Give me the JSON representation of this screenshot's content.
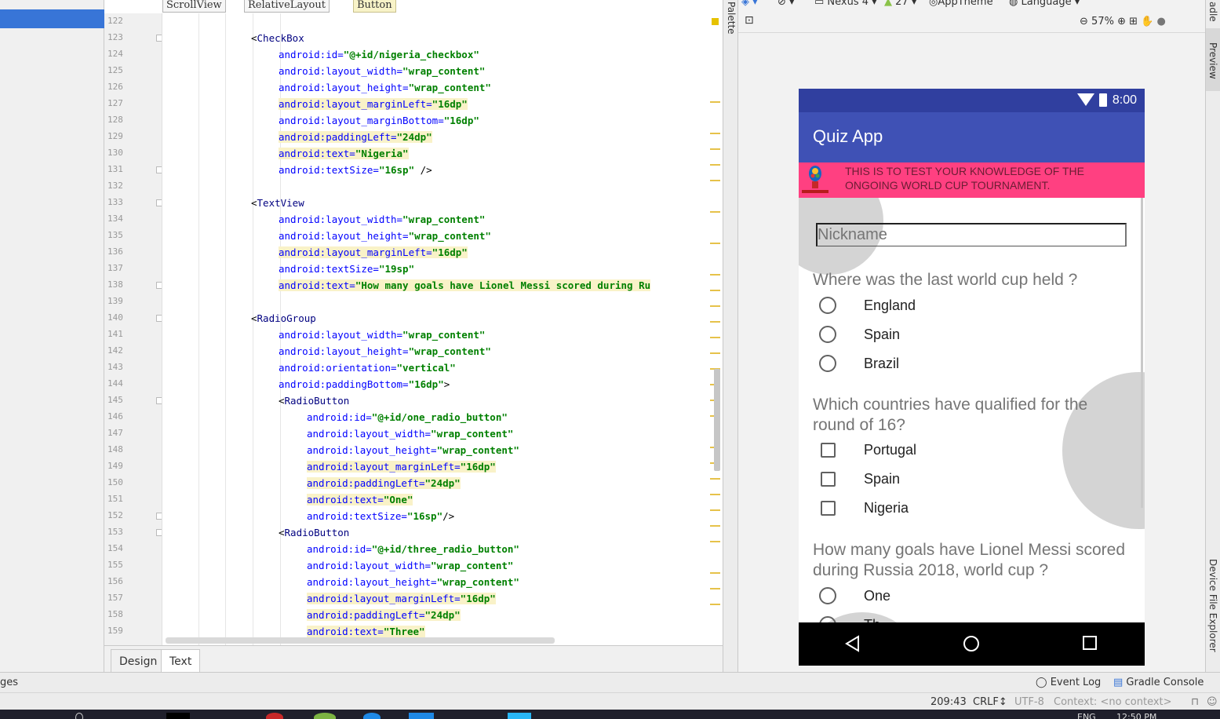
{
  "breadcrumb": [
    "ScrollView",
    "RelativeLayout",
    "Button"
  ],
  "gutter": {
    "line_numbers": [
      "122",
      "123",
      "124",
      "125",
      "126",
      "127",
      "128",
      "129",
      "130",
      "131",
      "132",
      "133",
      "134",
      "135",
      "136",
      "137",
      "138",
      "139",
      "140",
      "141",
      "142",
      "143",
      "144",
      "145",
      "146",
      "147",
      "148",
      "149",
      "150",
      "151",
      "152",
      "153",
      "154",
      "155",
      "156",
      "157",
      "158",
      "159"
    ]
  },
  "code_lines": [
    {
      "indent": 0,
      "parts": []
    },
    {
      "indent": 1,
      "parts": [
        {
          "t": "<",
          "c": "punc"
        },
        {
          "t": "CheckBox",
          "c": "tag"
        }
      ]
    },
    {
      "indent": 2,
      "hl": false,
      "parts": [
        {
          "t": "android:id=",
          "c": "attr"
        },
        {
          "t": "\"@+id/nigeria_checkbox\"",
          "c": "val"
        }
      ]
    },
    {
      "indent": 2,
      "hl": false,
      "parts": [
        {
          "t": "android:layout_width=",
          "c": "attr"
        },
        {
          "t": "\"wrap_content\"",
          "c": "val"
        }
      ]
    },
    {
      "indent": 2,
      "hl": false,
      "parts": [
        {
          "t": "android:layout_height=",
          "c": "attr"
        },
        {
          "t": "\"wrap_content\"",
          "c": "val"
        }
      ]
    },
    {
      "indent": 2,
      "hl": true,
      "parts": [
        {
          "t": "android:layout_marginLeft=",
          "c": "attr"
        },
        {
          "t": "\"16dp\"",
          "c": "val"
        }
      ]
    },
    {
      "indent": 2,
      "hl": false,
      "parts": [
        {
          "t": "android:layout_marginBottom=",
          "c": "attr"
        },
        {
          "t": "\"16dp\"",
          "c": "val"
        }
      ]
    },
    {
      "indent": 2,
      "hl": true,
      "parts": [
        {
          "t": "android:paddingLeft=",
          "c": "attr"
        },
        {
          "t": "\"24dp\"",
          "c": "val"
        }
      ]
    },
    {
      "indent": 2,
      "hl": true,
      "parts": [
        {
          "t": "android:text=",
          "c": "attr"
        },
        {
          "t": "\"Nigeria\"",
          "c": "val"
        }
      ]
    },
    {
      "indent": 2,
      "hl": false,
      "parts": [
        {
          "t": "android:textSize=",
          "c": "attr"
        },
        {
          "t": "\"16sp\"",
          "c": "val"
        },
        {
          "t": " />",
          "c": "punc"
        }
      ]
    },
    {
      "indent": 0,
      "parts": []
    },
    {
      "indent": 1,
      "parts": [
        {
          "t": "<",
          "c": "punc"
        },
        {
          "t": "TextView",
          "c": "tag"
        }
      ]
    },
    {
      "indent": 2,
      "hl": false,
      "parts": [
        {
          "t": "android:layout_width=",
          "c": "attr"
        },
        {
          "t": "\"wrap_content\"",
          "c": "val"
        }
      ]
    },
    {
      "indent": 2,
      "hl": false,
      "parts": [
        {
          "t": "android:layout_height=",
          "c": "attr"
        },
        {
          "t": "\"wrap_content\"",
          "c": "val"
        }
      ]
    },
    {
      "indent": 2,
      "hl": true,
      "parts": [
        {
          "t": "android:layout_marginLeft=",
          "c": "attr"
        },
        {
          "t": "\"16dp\"",
          "c": "val"
        }
      ]
    },
    {
      "indent": 2,
      "hl": false,
      "parts": [
        {
          "t": "android:textSize=",
          "c": "attr"
        },
        {
          "t": "\"19sp\"",
          "c": "val"
        }
      ]
    },
    {
      "indent": 2,
      "hl": true,
      "parts": [
        {
          "t": "android:text=",
          "c": "attr"
        },
        {
          "t": "\"How many goals have Lionel Messi scored during Ru",
          "c": "val"
        }
      ]
    },
    {
      "indent": 0,
      "parts": []
    },
    {
      "indent": 1,
      "parts": [
        {
          "t": "<",
          "c": "punc"
        },
        {
          "t": "RadioGroup",
          "c": "tag"
        }
      ]
    },
    {
      "indent": 2,
      "hl": false,
      "parts": [
        {
          "t": "android:layout_width=",
          "c": "attr"
        },
        {
          "t": "\"wrap_content\"",
          "c": "val"
        }
      ]
    },
    {
      "indent": 2,
      "hl": false,
      "parts": [
        {
          "t": "android:layout_height=",
          "c": "attr"
        },
        {
          "t": "\"wrap_content\"",
          "c": "val"
        }
      ]
    },
    {
      "indent": 2,
      "hl": false,
      "parts": [
        {
          "t": "android:orientation=",
          "c": "attr"
        },
        {
          "t": "\"vertical\"",
          "c": "val"
        }
      ]
    },
    {
      "indent": 2,
      "hl": false,
      "parts": [
        {
          "t": "android:paddingBottom=",
          "c": "attr"
        },
        {
          "t": "\"16dp\"",
          "c": "val"
        },
        {
          "t": ">",
          "c": "punc"
        }
      ]
    },
    {
      "indent": 2,
      "parts": [
        {
          "t": "<",
          "c": "punc"
        },
        {
          "t": "RadioButton",
          "c": "tag"
        }
      ]
    },
    {
      "indent": 3,
      "hl": false,
      "parts": [
        {
          "t": "android:id=",
          "c": "attr"
        },
        {
          "t": "\"@+id/one_radio_button\"",
          "c": "val"
        }
      ]
    },
    {
      "indent": 3,
      "hl": false,
      "parts": [
        {
          "t": "android:layout_width=",
          "c": "attr"
        },
        {
          "t": "\"wrap_content\"",
          "c": "val"
        }
      ]
    },
    {
      "indent": 3,
      "hl": false,
      "parts": [
        {
          "t": "android:layout_height=",
          "c": "attr"
        },
        {
          "t": "\"wrap_content\"",
          "c": "val"
        }
      ]
    },
    {
      "indent": 3,
      "hl": true,
      "parts": [
        {
          "t": "android:layout_marginLeft=",
          "c": "attr"
        },
        {
          "t": "\"16dp\"",
          "c": "val"
        }
      ]
    },
    {
      "indent": 3,
      "hl": true,
      "parts": [
        {
          "t": "android:paddingLeft=",
          "c": "attr"
        },
        {
          "t": "\"24dp\"",
          "c": "val"
        }
      ]
    },
    {
      "indent": 3,
      "hl": true,
      "parts": [
        {
          "t": "android:text=",
          "c": "attr"
        },
        {
          "t": "\"One\"",
          "c": "val"
        }
      ]
    },
    {
      "indent": 3,
      "hl": false,
      "parts": [
        {
          "t": "android:textSize=",
          "c": "attr"
        },
        {
          "t": "\"16sp\"",
          "c": "val"
        },
        {
          "t": "/>",
          "c": "punc"
        }
      ]
    },
    {
      "indent": 2,
      "parts": [
        {
          "t": "<",
          "c": "punc"
        },
        {
          "t": "RadioButton",
          "c": "tag"
        }
      ]
    },
    {
      "indent": 3,
      "hl": false,
      "parts": [
        {
          "t": "android:id=",
          "c": "attr"
        },
        {
          "t": "\"@+id/three_radio_button\"",
          "c": "val"
        }
      ]
    },
    {
      "indent": 3,
      "hl": false,
      "parts": [
        {
          "t": "android:layout_width=",
          "c": "attr"
        },
        {
          "t": "\"wrap_content\"",
          "c": "val"
        }
      ]
    },
    {
      "indent": 3,
      "hl": false,
      "parts": [
        {
          "t": "android:layout_height=",
          "c": "attr"
        },
        {
          "t": "\"wrap_content\"",
          "c": "val"
        }
      ]
    },
    {
      "indent": 3,
      "hl": true,
      "parts": [
        {
          "t": "android:layout_marginLeft=",
          "c": "attr"
        },
        {
          "t": "\"16dp\"",
          "c": "val"
        }
      ]
    },
    {
      "indent": 3,
      "hl": true,
      "parts": [
        {
          "t": "android:paddingLeft=",
          "c": "attr"
        },
        {
          "t": "\"24dp\"",
          "c": "val"
        }
      ]
    },
    {
      "indent": 3,
      "hl": true,
      "parts": [
        {
          "t": "android:text=",
          "c": "attr"
        },
        {
          "t": "\"Three\"",
          "c": "val"
        }
      ]
    }
  ],
  "editor_tabs": {
    "design": "Design",
    "text": "Text"
  },
  "palette": {
    "label": "Palette"
  },
  "preview_toolbar": {
    "device": "Nexus 4",
    "api": "27",
    "theme": "AppTheme",
    "language": "Language",
    "zoom": "57%"
  },
  "phone": {
    "time": "8:00",
    "app_title": "Quiz App",
    "banner_text": "THIS IS TO TEST YOUR KNOWLEDGE OF THE ONGOING WORLD CUP TOURNAMENT.",
    "nickname_placeholder": "Nickname",
    "q1": "Where was the last world cup held ?",
    "q1_options": [
      "England",
      "Spain",
      "Brazil"
    ],
    "q2": "Which countries have qualified for the round of 16?",
    "q2_options": [
      "Portugal",
      "Spain",
      "Nigeria"
    ],
    "q3": "How many goals have Lionel Messi scored during Russia 2018, world cup ?",
    "q3_options": [
      "One",
      "Th"
    ]
  },
  "side_strip": {
    "top_label": "adle",
    "preview": "Preview",
    "device_file_explorer": "Device File Explorer"
  },
  "tool_bar": {
    "left_fragment": "ges",
    "event_log": "Event Log",
    "gradle_console": "Gradle Console"
  },
  "status_bar": {
    "position": "209:43",
    "line_sep": "CRLF↕",
    "encoding": "UTF-8",
    "context": "Context: <no context>"
  },
  "taskbar": {
    "lang": "ENG",
    "time": "12:50 PM"
  },
  "colors": {
    "status_bar": "#303f9f",
    "app_bar": "#3f51b5",
    "banner": "#ff4081",
    "selection": "#3875d7"
  }
}
